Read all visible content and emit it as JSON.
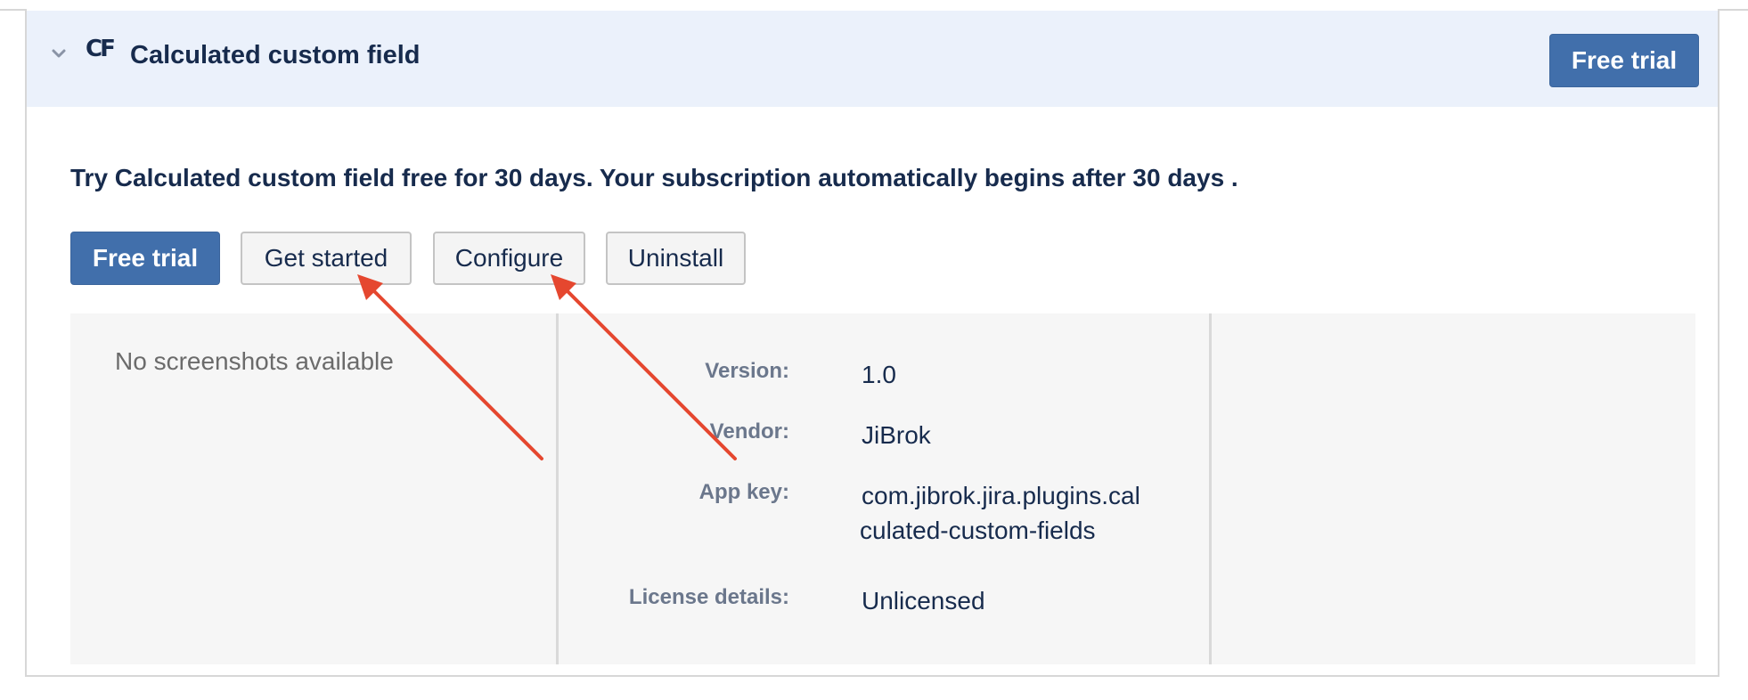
{
  "app": {
    "logo_text": "CF",
    "title": "Calculated custom field"
  },
  "header": {
    "free_trial_label": "Free trial"
  },
  "trial_message": "Try Calculated custom field free for 30 days. Your subscription automatically begins after 30 days .",
  "actions": {
    "free_trial_label": "Free trial",
    "get_started_label": "Get started",
    "configure_label": "Configure",
    "uninstall_label": "Uninstall"
  },
  "screenshots": {
    "empty_text": "No screenshots available"
  },
  "details": {
    "version_label": "Version:",
    "version_value": "1.0",
    "vendor_label": "Vendor:",
    "vendor_value": "JiBrok",
    "app_key_label": "App key:",
    "app_key_line1": "com.jibrok.jira.plugins.cal",
    "app_key_line2": "culated-custom-fields",
    "license_label": "License details:",
    "license_value": "Unlicensed"
  },
  "colors": {
    "primary_button": "#416fab",
    "header_background": "#ebf1fb",
    "annotation_arrow": "#e5472f"
  },
  "icons": {
    "collapse": "chevron-down-icon",
    "annotation": "arrow-annotation"
  }
}
